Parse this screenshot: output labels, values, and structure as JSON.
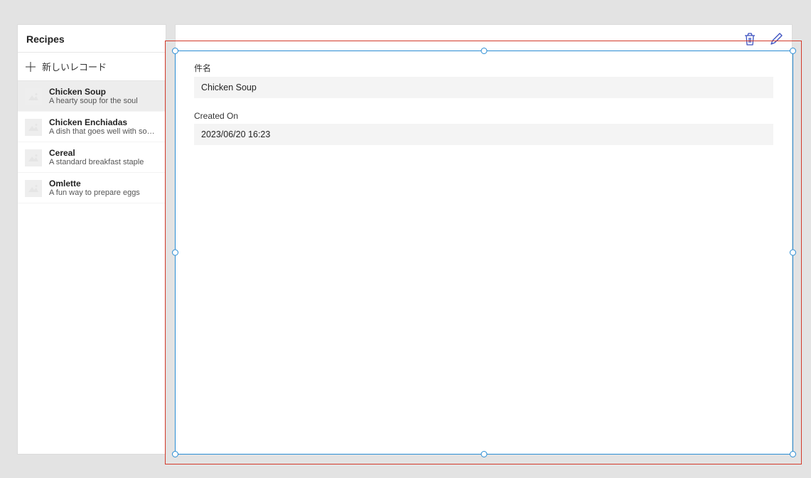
{
  "sidebar": {
    "title": "Recipes",
    "new_record_label": "新しいレコード",
    "items": [
      {
        "title": "Chicken Soup",
        "subtitle": "A hearty soup for the soul",
        "selected": true
      },
      {
        "title": "Chicken Enchiadas",
        "subtitle": "A dish that goes well with sour cream",
        "selected": false
      },
      {
        "title": "Cereal",
        "subtitle": "A standard breakfast staple",
        "selected": false
      },
      {
        "title": "Omlette",
        "subtitle": "A fun way to prepare eggs",
        "selected": false
      }
    ]
  },
  "toolbar": {
    "delete_icon": "trash-icon",
    "edit_icon": "pencil-icon"
  },
  "form": {
    "fields": [
      {
        "label": "件名",
        "value": "Chicken Soup"
      },
      {
        "label": "Created On",
        "value": "2023/06/20 16:23"
      }
    ]
  },
  "colors": {
    "selection_blue": "#2a8dd4",
    "annotation_red": "#d43a2a"
  }
}
